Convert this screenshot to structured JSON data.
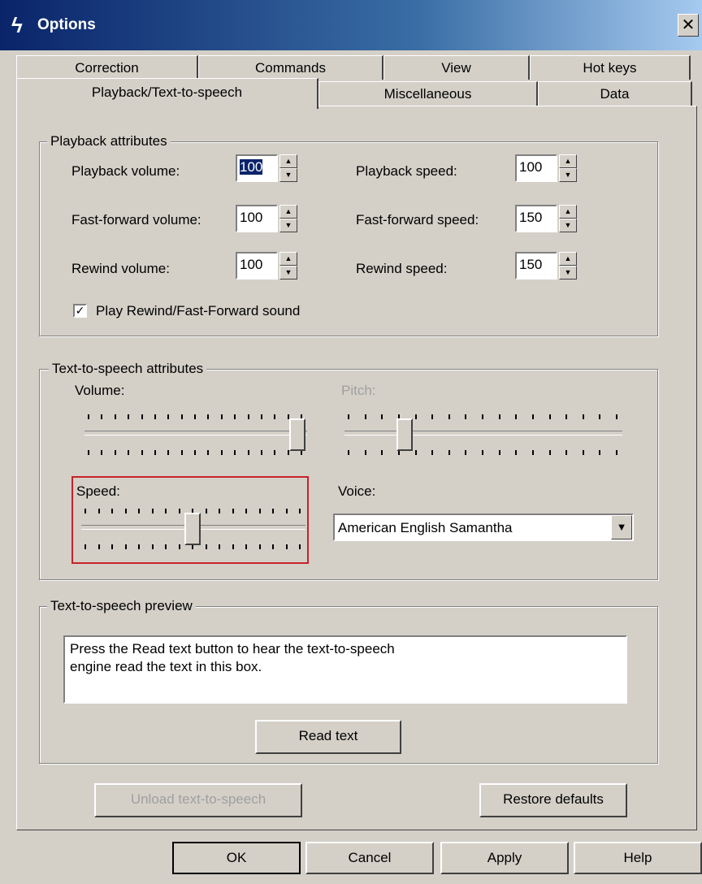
{
  "window": {
    "title": "Options",
    "close_glyph": "✕"
  },
  "tabs": {
    "row_back": [
      "Correction",
      "Commands",
      "View",
      "Hot keys"
    ],
    "row_front": [
      "Playback/Text-to-speech",
      "Miscellaneous",
      "Data"
    ],
    "selected": "Playback/Text-to-speech"
  },
  "playback": {
    "legend": "Playback attributes",
    "playback_volume": {
      "label": "Playback volume:",
      "value": "100"
    },
    "playback_speed": {
      "label": "Playback speed:",
      "value": "100"
    },
    "ff_volume": {
      "label": "Fast-forward volume:",
      "value": "100"
    },
    "ff_speed": {
      "label": "Fast-forward speed:",
      "value": "150"
    },
    "rewind_volume": {
      "label": "Rewind volume:",
      "value": "100"
    },
    "rewind_speed": {
      "label": "Rewind speed:",
      "value": "150"
    },
    "sound_checkbox": {
      "label": "Play Rewind/Fast-Forward sound",
      "checked": true
    }
  },
  "tts": {
    "legend": "Text-to-speech attributes",
    "volume": {
      "label": "Volume:",
      "level": 1.0
    },
    "pitch": {
      "label": "Pitch:",
      "level": 0.2,
      "enabled": false
    },
    "speed": {
      "label": "Speed:",
      "level": 0.5
    },
    "voice": {
      "label": "Voice:",
      "selected": "American English Samantha"
    }
  },
  "preview": {
    "legend": "Text-to-speech preview",
    "text_line1": "Press the Read text button to hear the text-to-speech",
    "text_line2": "engine read the text in this box.",
    "read_button": "Read text"
  },
  "buttons": {
    "unload": "Unload text-to-speech",
    "restore": "Restore defaults",
    "ok": "OK",
    "cancel": "Cancel",
    "apply": "Apply",
    "help": "Help"
  },
  "colors": {
    "highlight": "#c8202c",
    "titlebar_start": "#0a246a",
    "titlebar_end": "#a6caf0"
  }
}
